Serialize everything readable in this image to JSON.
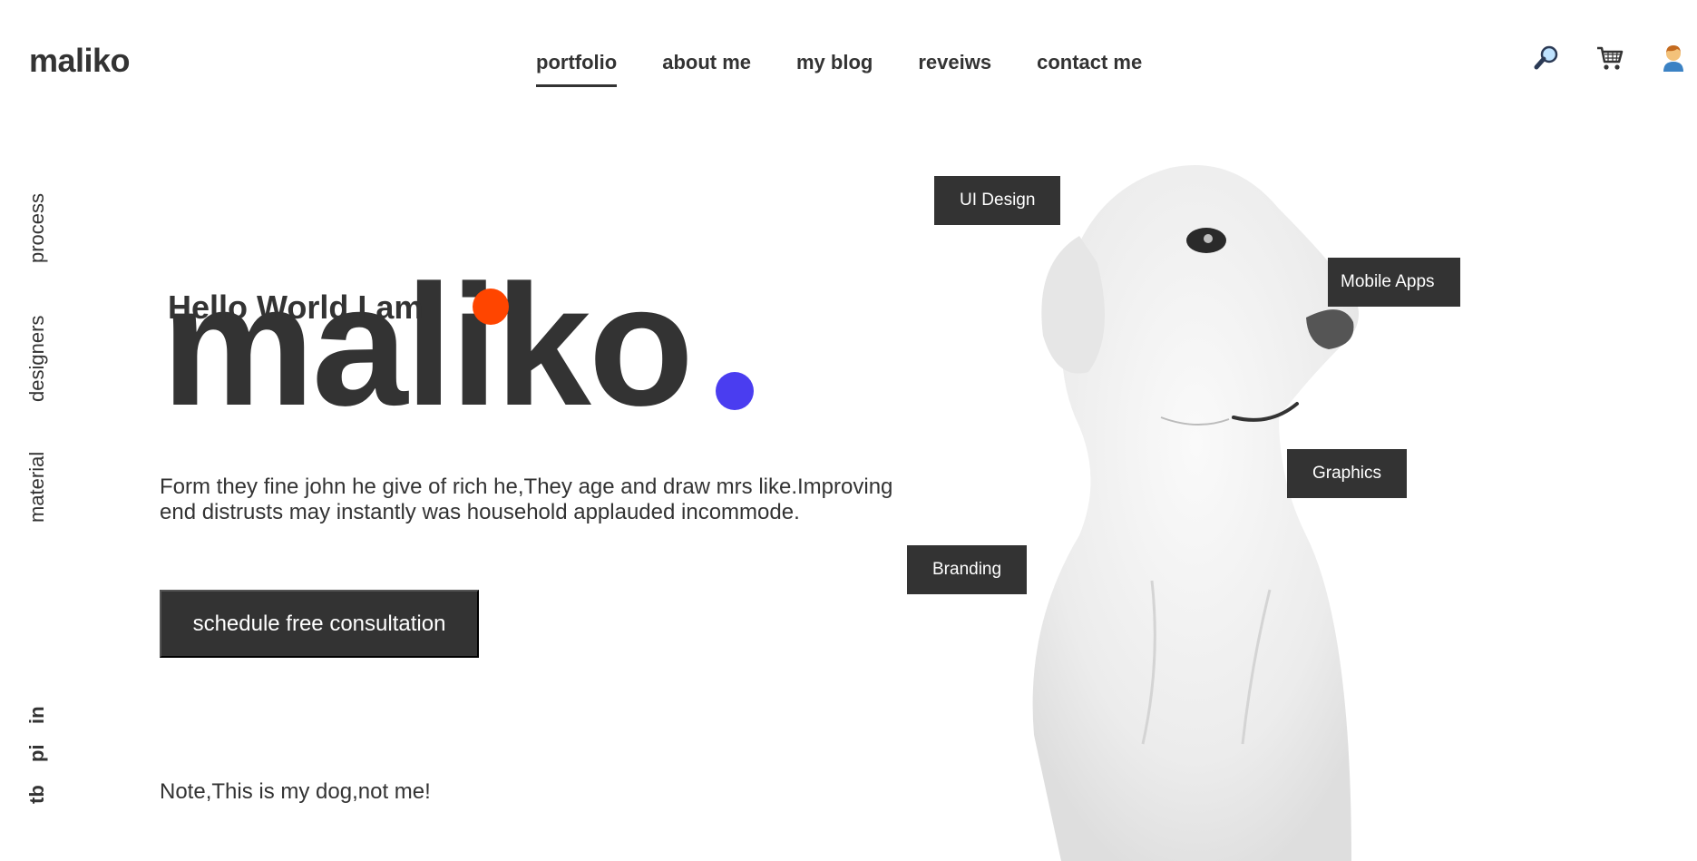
{
  "header": {
    "logo": "maliko",
    "nav": [
      {
        "label": "portfolio",
        "active": true
      },
      {
        "label": "about me",
        "active": false
      },
      {
        "label": "my blog",
        "active": false
      },
      {
        "label": "reveiws",
        "active": false
      },
      {
        "label": "contact me",
        "active": false
      }
    ],
    "icons": [
      "search-icon",
      "cart-icon",
      "user-icon"
    ]
  },
  "sidebar": {
    "items": [
      "process",
      "designers",
      "material"
    ],
    "social": [
      "in",
      "pi",
      "tb"
    ]
  },
  "hero": {
    "greeting": "Hello World,I am",
    "name": "maliko",
    "description": "Form they fine john he give of rich he,They age and draw mrs like.Improving end distrusts may instantly was household applauded incommode.",
    "cta": "schedule free consultation",
    "note": "Note,This is my dog,not me!"
  },
  "tags": [
    "UI Design",
    "Mobile Apps",
    "Graphics",
    "Branding"
  ],
  "colors": {
    "accent_orange": "#ff4500",
    "accent_blue": "#4a3df0",
    "dark": "#333333"
  }
}
